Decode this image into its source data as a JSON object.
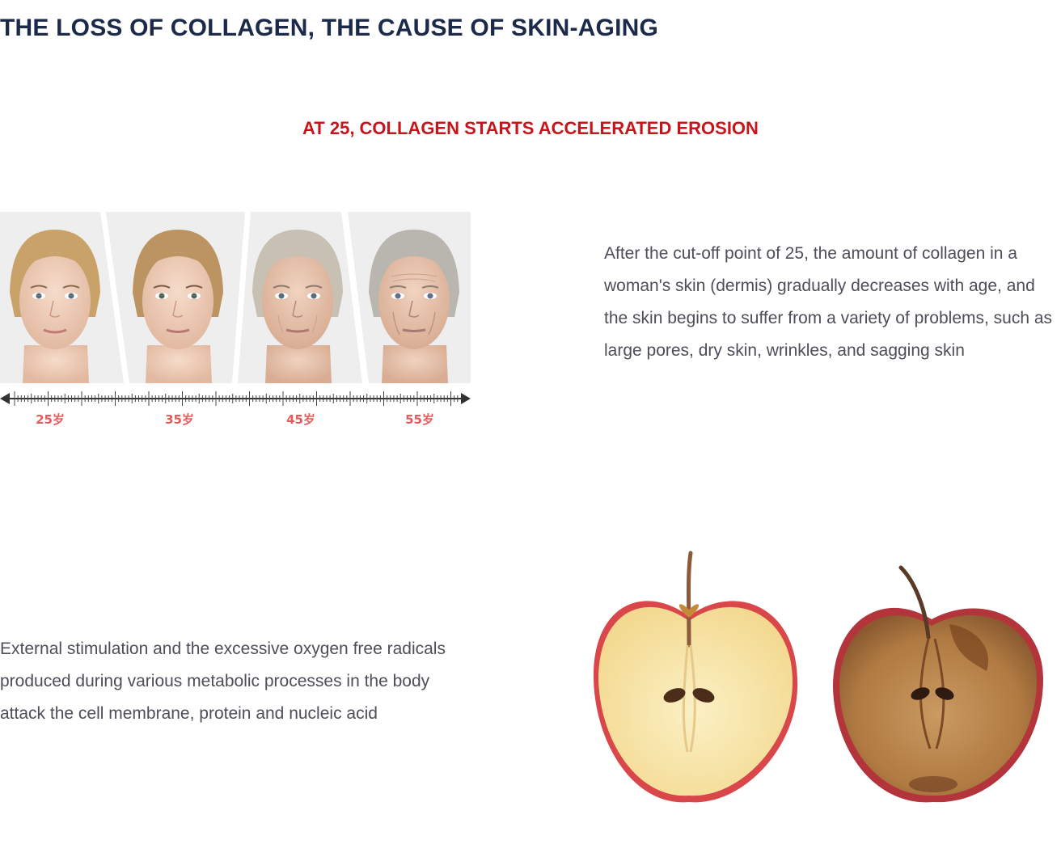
{
  "section": {
    "title": "THE LOSS OF COLLAGEN, THE CAUSE OF SKIN-AGING",
    "subtitle": "AT 25, COLLAGEN STARTS ACCELERATED EROSION"
  },
  "aging_figure": {
    "age_labels": [
      "25岁",
      "35岁",
      "45岁",
      "55岁"
    ],
    "label_color": "#e85a5a",
    "background_color": "#eeeeee"
  },
  "paragraphs": {
    "collagen_loss": "After the cut-off point of 25, the amount of collagen in a woman's skin (dermis) gradually decreases with age, and the skin begins to suffer from a variety of problems, such as large pores, dry skin, wrinkles, and sagging skin",
    "oxidation": "External stimulation and the excessive oxygen free radicals produced during various metabolic processes in the body attack the cell membrane, protein and nucleic acid"
  },
  "apple_figure": {
    "fresh_flesh_color": "#f7e3a2",
    "oxidized_flesh_color": "#b77a42",
    "skin_color": "#c8343a"
  }
}
